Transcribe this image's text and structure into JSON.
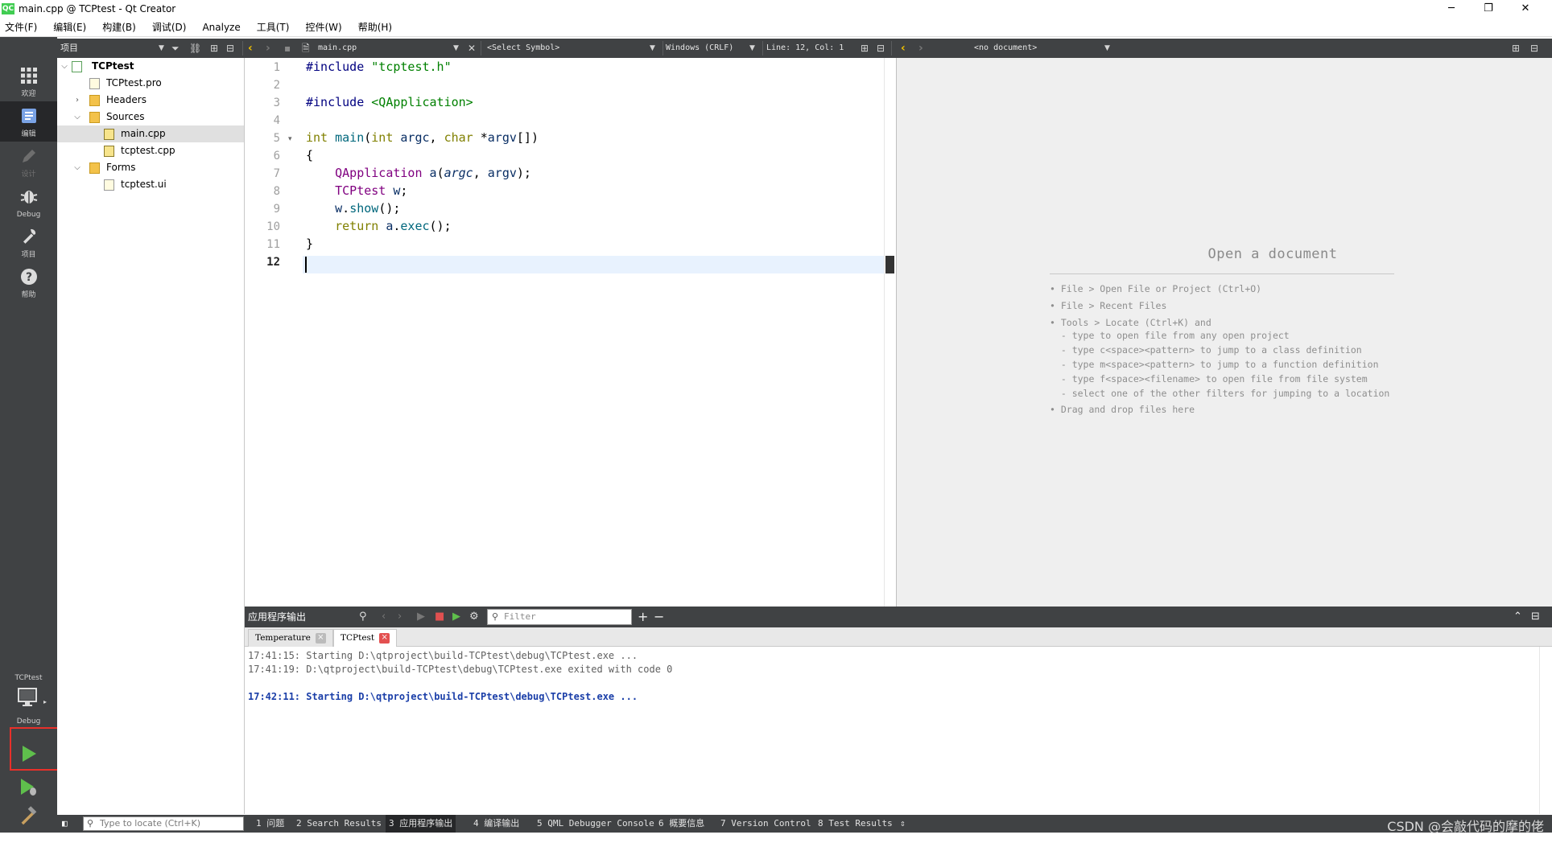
{
  "window": {
    "title": "main.cpp @ TCPtest - Qt Creator",
    "app_icon": "QC",
    "controls": {
      "minimize": "─",
      "restore": "❐",
      "close": "✕"
    }
  },
  "menu": [
    "文件(F)",
    "编辑(E)",
    "构建(B)",
    "调试(D)",
    "Analyze",
    "工具(T)",
    "控件(W)",
    "帮助(H)"
  ],
  "modes": [
    {
      "label": "欢迎",
      "icon": "grid-icon"
    },
    {
      "label": "编辑",
      "icon": "edit-icon"
    },
    {
      "label": "设计",
      "icon": "pen-icon"
    },
    {
      "label": "Debug",
      "icon": "bug-icon"
    },
    {
      "label": "项目",
      "icon": "wrench-icon"
    },
    {
      "label": "帮助",
      "icon": "help-icon"
    }
  ],
  "kit": {
    "project": "TCPtest",
    "config": "Debug"
  },
  "toolbar": {
    "projects_label": "项目",
    "file_combo": "main.cpp",
    "symbol_combo": "<Select Symbol>",
    "line_ending": "Windows (CRLF)",
    "position": "Line: 12, Col: 1",
    "right_doc_combo": "<no document>"
  },
  "tree": {
    "root": "TCPtest",
    "items": [
      {
        "label": "TCPtest.pro"
      },
      {
        "label": "Headers"
      },
      {
        "label": "Sources"
      },
      {
        "label": "main.cpp"
      },
      {
        "label": "tcptest.cpp"
      },
      {
        "label": "Forms"
      },
      {
        "label": "tcptest.ui"
      }
    ]
  },
  "editor": {
    "line_numbers": [
      "1",
      "2",
      "3",
      "4",
      "5",
      "6",
      "7",
      "8",
      "9",
      "10",
      "11",
      "12"
    ],
    "current_line": "12"
  },
  "right_pane": {
    "title": "Open a document",
    "hints": [
      "• File > Open File or Project (Ctrl+O)",
      "• File > Recent Files",
      "• Tools > Locate (Ctrl+K) and",
      "  - type to open file from any open project",
      "  - type c<space><pattern> to jump to a class definition",
      "  - type m<space><pattern> to jump to a function definition",
      "  - type f<space><filename> to open file from file system",
      "  - select one of the other filters for jumping to a location",
      "• Drag and drop files here"
    ]
  },
  "output": {
    "title": "应用程序输出",
    "filter_placeholder": "Filter",
    "tabs": [
      "Temperature",
      "TCPtest"
    ],
    "lines": [
      "17:41:15: Starting D:\\qtproject\\build-TCPtest\\debug\\TCPtest.exe ...",
      "17:41:19: D:\\qtproject\\build-TCPtest\\debug\\TCPtest.exe exited with code 0",
      "17:42:11: Starting D:\\qtproject\\build-TCPtest\\debug\\TCPtest.exe ..."
    ]
  },
  "status": {
    "locator_placeholder": "Type to locate (Ctrl+K)",
    "panes": [
      "1 问题",
      "2 Search Results",
      "3 应用程序输出",
      "4 编译输出",
      "5 QML Debugger Console",
      "6 概要信息",
      "7 Version Control",
      "8 Test Results"
    ]
  },
  "watermark": "CSDN @会敲代码的摩的佬",
  "colors": {
    "sidebar": "#404244",
    "accent_green": "#41cd52",
    "annotation_red": "#e8302a"
  }
}
